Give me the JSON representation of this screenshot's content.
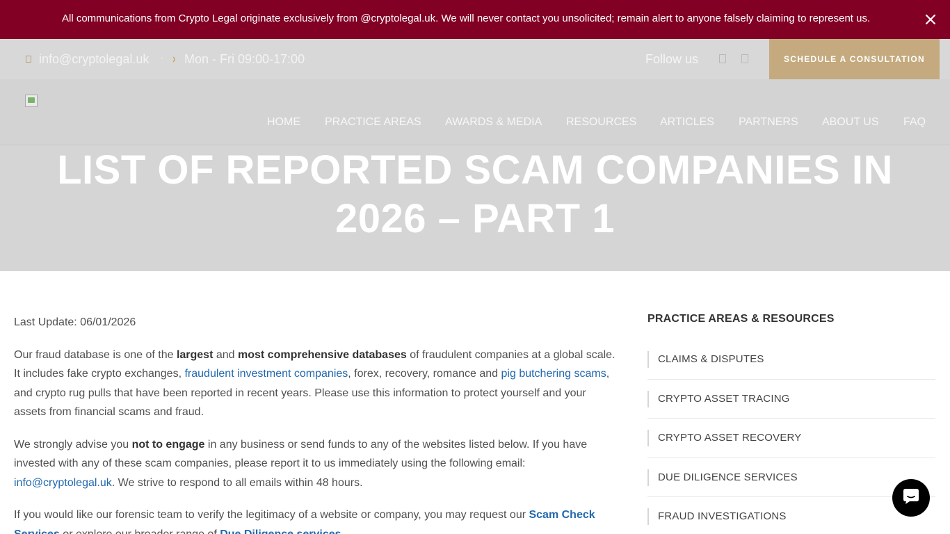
{
  "alert": {
    "text": "All communications from Crypto Legal originate exclusively from @cryptolegal.uk. We will never contact you unsolicited; remain alert to anyone falsely claiming to represent us.",
    "close_icon": "close-icon"
  },
  "topbar": {
    "email": "info@cryptolegal.uk",
    "separator": "·",
    "hours": "Mon - Fri 09:00-17:00",
    "follow_label": "Follow us",
    "social_icons": [
      "facebook-icon",
      "linkedin-icon"
    ],
    "cta_label": "SCHEDULE A CONSULTATION"
  },
  "nav": {
    "items": [
      "HOME",
      "PRACTICE AREAS",
      "AWARDS & MEDIA",
      "RESOURCES",
      "ARTICLES",
      "PARTNERS",
      "ABOUT US",
      "FAQ"
    ]
  },
  "hero": {
    "title_line1": "LIST OF REPORTED SCAM COMPANIES IN",
    "title_line2": "2026 – PART 1"
  },
  "content": {
    "last_update": "Last Update: 06/01/2026",
    "p1": {
      "t1": "Our fraud database is one of the ",
      "b1": "largest",
      "t2": " and ",
      "b2": "most comprehensive databases",
      "t3": " of fraudulent companies at a global scale. It includes fake crypto exchanges, ",
      "l1": "fraudulent investment companies",
      "t4": ", forex, recovery, romance and ",
      "l2": "pig butchering scams",
      "t5": ", and crypto rug pulls that have been reported in recent years. Please use this information to protect yourself and your assets from financial scams and fraud."
    },
    "p2": {
      "t1": "We strongly advise you ",
      "b1": "not to engage",
      "t2": " in any business or send funds to any of the websites listed below. If you have invested with any of these scam companies, please report it to us immediately using the following email: ",
      "l1": "info@cryptolegal.uk",
      "t3": ". We strive to respond to all emails within 48 hours."
    },
    "p3": {
      "t1": "If you would like our forensic team to verify the legitimacy of a website or company, you may request our ",
      "l1": "Scam Check Services",
      "t2": " or explore our broader range of ",
      "l2": "Due Diligence services",
      "t3": "."
    }
  },
  "sidebar": {
    "title": "PRACTICE AREAS & RESOURCES",
    "items": [
      "CLAIMS & DISPUTES",
      "CRYPTO ASSET TRACING",
      "CRYPTO ASSET RECOVERY",
      "DUE DILIGENCE SERVICES",
      "FRAUD INVESTIGATIONS"
    ]
  },
  "chat": {
    "icon": "chat-icon"
  },
  "colors": {
    "alert_bg": "#820024",
    "cta_bg": "#c4aa7e",
    "link": "#2168ae",
    "hero_bg": "#d5d5d5"
  }
}
